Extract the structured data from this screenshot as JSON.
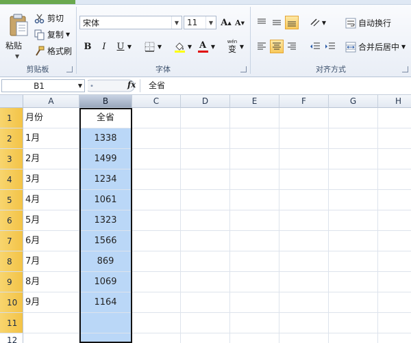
{
  "ribbon": {
    "clipboard": {
      "paste_label": "粘贴",
      "cut_label": "剪切",
      "copy_label": "复制",
      "format_painter_label": "格式刷",
      "group_label": "剪贴板"
    },
    "font": {
      "font_name": "宋体",
      "font_size": "11",
      "grow_label": "A",
      "shrink_label": "A",
      "bold_label": "B",
      "italic_label": "I",
      "underline_label": "U",
      "font_color_label": "A",
      "phonetic_label": "wén",
      "phonetic_char": "变",
      "group_label": "字体"
    },
    "alignment": {
      "wrap_text_label": "自动换行",
      "merge_center_label": "合并后居中",
      "group_label": "对齐方式"
    }
  },
  "formula_bar": {
    "name_box": "B1",
    "fx_label": "fx",
    "formula": "全省"
  },
  "grid": {
    "columns": [
      "A",
      "B",
      "C",
      "D",
      "E",
      "F",
      "G",
      "H"
    ],
    "rows": [
      "1",
      "2",
      "3",
      "4",
      "5",
      "6",
      "7",
      "8",
      "9",
      "10",
      "11",
      "12"
    ],
    "col_a": [
      "月份",
      "1月",
      "2月",
      "3月",
      "4月",
      "5月",
      "6月",
      "7月",
      "8月",
      "9月",
      "",
      ""
    ],
    "col_b": [
      "全省",
      "1338",
      "1499",
      "1234",
      "1061",
      "1323",
      "1566",
      "869",
      "1069",
      "1164",
      "",
      ""
    ]
  },
  "colors": {
    "selection_fill": "#bad7f7",
    "row_header_selected": "#f5c94f",
    "active_align_button": "#f8c95c"
  }
}
